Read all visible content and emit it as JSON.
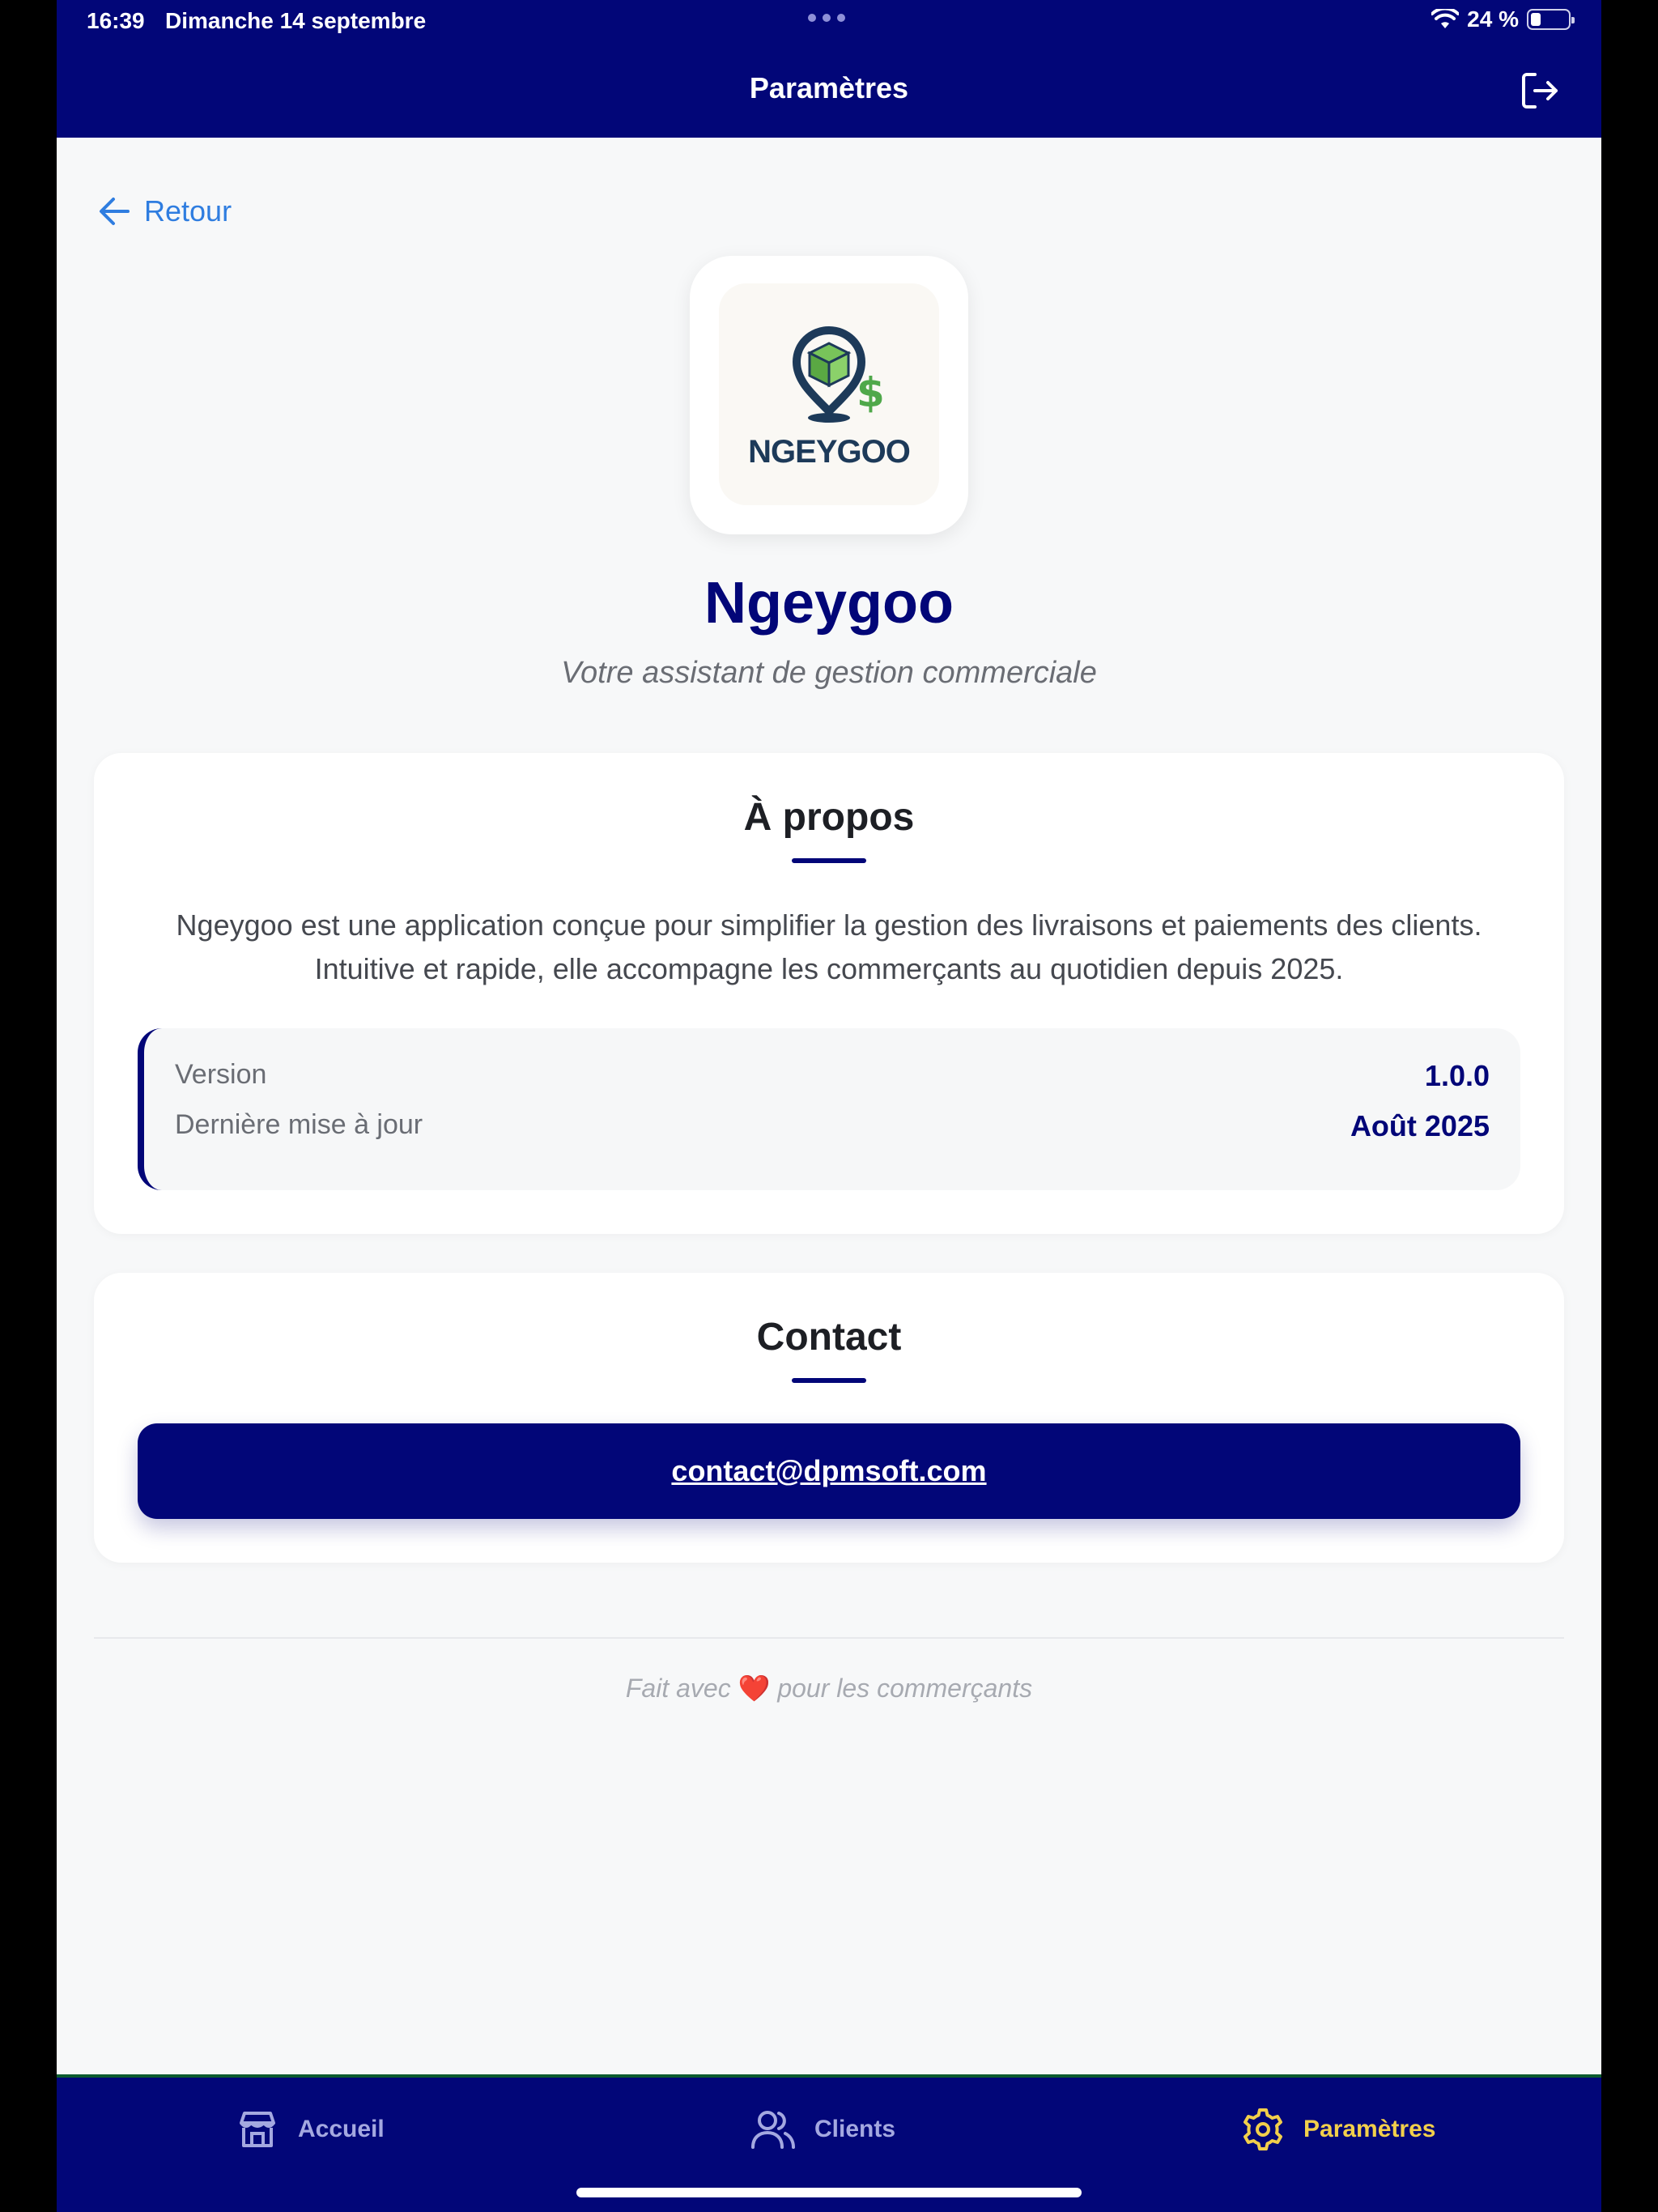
{
  "status_bar": {
    "time": "16:39",
    "date": "Dimanche 14 septembre",
    "battery": "24 %"
  },
  "header": {
    "title": "Paramètres"
  },
  "back": {
    "label": "Retour"
  },
  "app": {
    "logo_text": "NGEYGOO",
    "name": "Ngeygoo",
    "tagline": "Votre assistant de gestion commerciale"
  },
  "about": {
    "title": "À propos",
    "line1": "Ngeygoo est une application conçue pour simplifier la gestion des livraisons et paiements des clients.",
    "line2": "Intuitive et rapide, elle accompagne les commerçants au quotidien depuis 2025.",
    "version_label": "Version",
    "version_value": "1.0.0",
    "updated_label": "Dernière mise à jour",
    "updated_value": "Août 2025"
  },
  "contact": {
    "title": "Contact",
    "email": "contact@dpmsoft.com"
  },
  "footer": {
    "before": "Fait avec",
    "heart": "❤️",
    "after": "pour les commerçants"
  },
  "nav": {
    "items": [
      {
        "label": "Accueil",
        "active": false
      },
      {
        "label": "Clients",
        "active": false
      },
      {
        "label": "Paramètres",
        "active": true
      }
    ]
  },
  "colors": {
    "primary": "#020678",
    "accent": "#f2cf4b",
    "link": "#2f7de0",
    "background": "#f7f8f9"
  }
}
